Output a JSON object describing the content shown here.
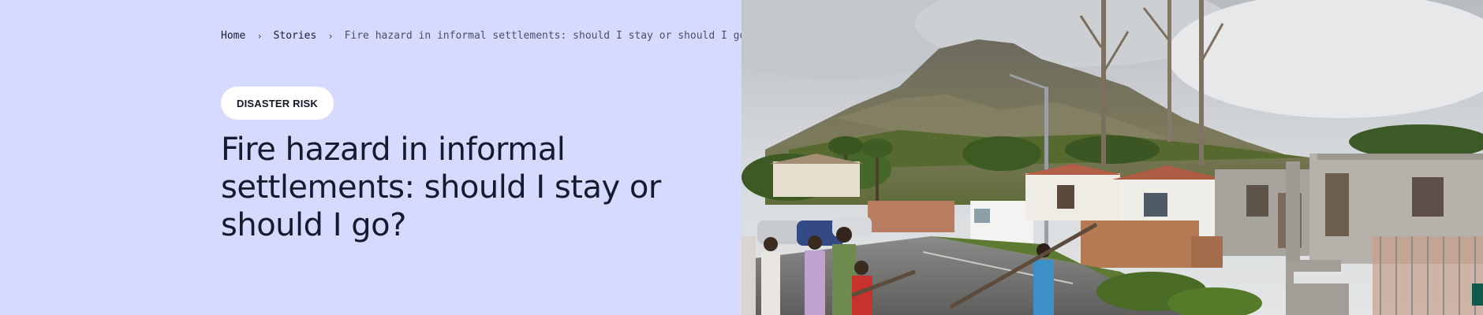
{
  "breadcrumb": {
    "home": "Home",
    "stories": "Stories",
    "current": "Fire hazard in informal settlements: should I stay or should I go?"
  },
  "tag": {
    "label": "DISASTER RISK"
  },
  "article": {
    "title": "Fire hazard in informal settlements: should I stay or should I go?"
  },
  "colors": {
    "hero_background": "#d5dafe",
    "tag_background": "#ffffff",
    "title_text": "#161a2e",
    "corner_badge": "#0f5a4a"
  },
  "icons": {
    "breadcrumb_separator": "chevron-right-icon"
  }
}
